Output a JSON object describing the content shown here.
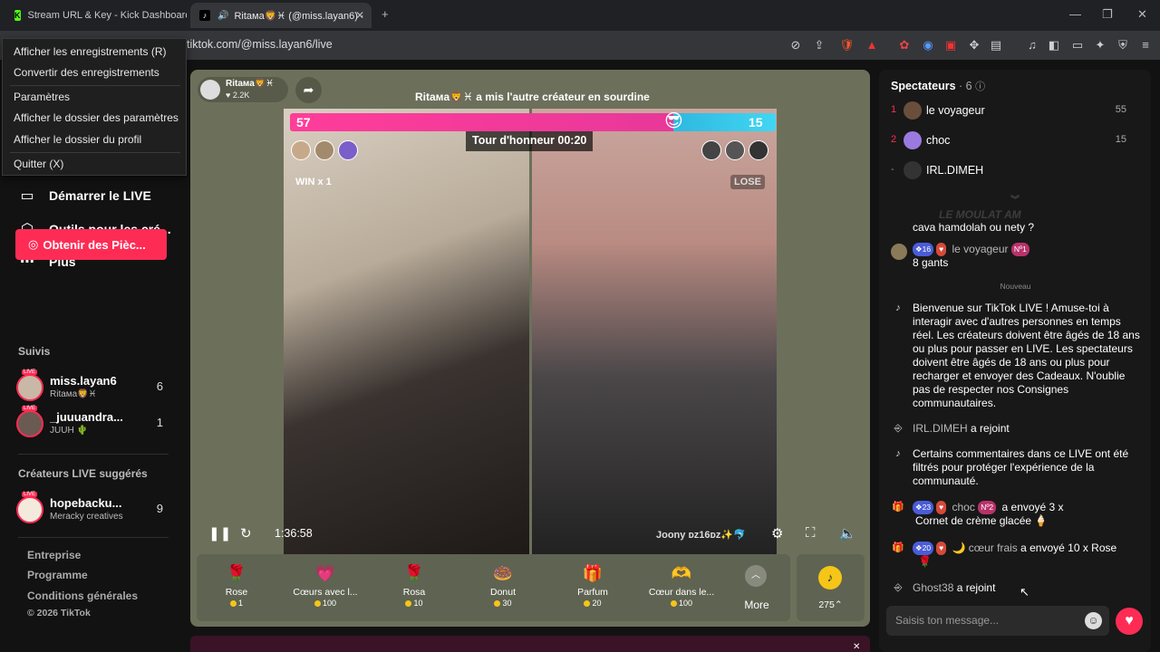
{
  "browser": {
    "tabs": [
      {
        "title": "Stream URL & Key - Kick Dashboard",
        "favicon": "K"
      },
      {
        "title": "Ritaмa🦁♓ (@miss.layan6) ·",
        "favicon": "♪"
      }
    ],
    "new_tab": "+",
    "url": "tiktok.com/@miss.layan6/live"
  },
  "context_menu": {
    "items": [
      "Afficher les enregistrements (R)",
      "Convertir des enregistrements",
      "Paramètres",
      "Afficher le dossier des paramètres",
      "Afficher le dossier du profil",
      "Quitter (X)"
    ]
  },
  "sidebar": {
    "nav": [
      {
        "label": "Démarrer le LIVE",
        "icon": "camera-icon"
      },
      {
        "label": "Outils pour les cré...",
        "icon": "tools-icon"
      },
      {
        "label": "Plus",
        "icon": "more-icon"
      }
    ],
    "coins_button": "Obtenir des Pièc...",
    "following_title": "Suivis",
    "following": [
      {
        "name": "miss.layan6",
        "sub": "Ritaмa🦁♓",
        "count": "6"
      },
      {
        "name": "_juuuandra...",
        "sub": "JUUH 🌵",
        "count": "1"
      }
    ],
    "suggested_title": "Créateurs LIVE suggérés",
    "suggested": [
      {
        "name": "hopebacku...",
        "sub": "Meracky creatives",
        "count": "9"
      }
    ],
    "footer": [
      "Entreprise",
      "Programme",
      "Conditions générales"
    ],
    "copyright": "© 2026 TikTok"
  },
  "live": {
    "host_name": "Ritaмa🦁♓",
    "host_likes": "♥ 2.2K",
    "notice": "Ritaмa🦁♓ a mis l'autre créateur en sourdine",
    "score_left": "57",
    "score_right": "15",
    "score_left_fraction": 0.79,
    "round_timer": "Tour d'honneur 00:20",
    "win_tag": "WIN x 1",
    "lose_tag": "LOSE",
    "elapsed": "1:36:58",
    "watermark": "Joony ᴅᴢ16ᴅᴢ✨🐬",
    "colors": {
      "pink": "#ff3d9a",
      "blue": "#41d6f3",
      "brand": "#fe2c55"
    }
  },
  "gifts": [
    {
      "name": "Rose",
      "price": "1",
      "icon": "🌹"
    },
    {
      "name": "Cœurs avec l...",
      "price": "100",
      "icon": "💗"
    },
    {
      "name": "Rosa",
      "price": "10",
      "icon": "🌹"
    },
    {
      "name": "Donut",
      "price": "30",
      "icon": "🍩"
    },
    {
      "name": "Parfum",
      "price": "20",
      "icon": "🎁"
    },
    {
      "name": "Cœur dans le...",
      "price": "100",
      "icon": "🫶"
    }
  ],
  "gifts_more": "More",
  "coin_balance": "275⌃",
  "viewers": {
    "title": "Spectateurs",
    "count": "· 6",
    "list": [
      {
        "rank": "1",
        "name": "le voyageur",
        "score": "55"
      },
      {
        "rank": "2",
        "name": "choc",
        "score": "15"
      },
      {
        "rank": "-",
        "name": "IRL.DIMEH",
        "score": ""
      }
    ]
  },
  "chat": {
    "faded_line": "LE MOULAT AM",
    "m1": "cava hamdolah ou nety ?",
    "m2_user": "le voyageur",
    "m2_badge": "16",
    "m2_rank": "Nº1",
    "m2_text": "8 gants",
    "new_divider": "Nouveau",
    "welcome": "Bienvenue sur TikTok LIVE ! Amuse-toi à interagir avec d'autres personnes en temps réel. Les créateurs doivent être âgés de 18 ans ou plus pour passer en LIVE. Les spectateurs doivent être âgés de 18 ans ou plus pour recharger et envoyer des Cadeaux. N'oublie pas de respecter nos Consignes communautaires.",
    "join1_user": "IRL.DIMEH",
    "join1_text": "a rejoint",
    "filter_note": "Certains commentaires dans ce LIVE ont été filtrés pour protéger l'expérience de la communauté.",
    "gift1_badge": "23",
    "gift1_user": "choc",
    "gift1_rank": "Nº2",
    "gift1_text": "a envoyé 3 x",
    "gift1_item": "Cornet de crème glacée 🍦",
    "gift2_badge": "20",
    "gift2_user": "cœur frais",
    "gift2_text": "a envoyé 10 x Rose",
    "join2_user": "Ghost38",
    "join2_text": "a rejoint",
    "input_placeholder": "Saisis ton message..."
  }
}
